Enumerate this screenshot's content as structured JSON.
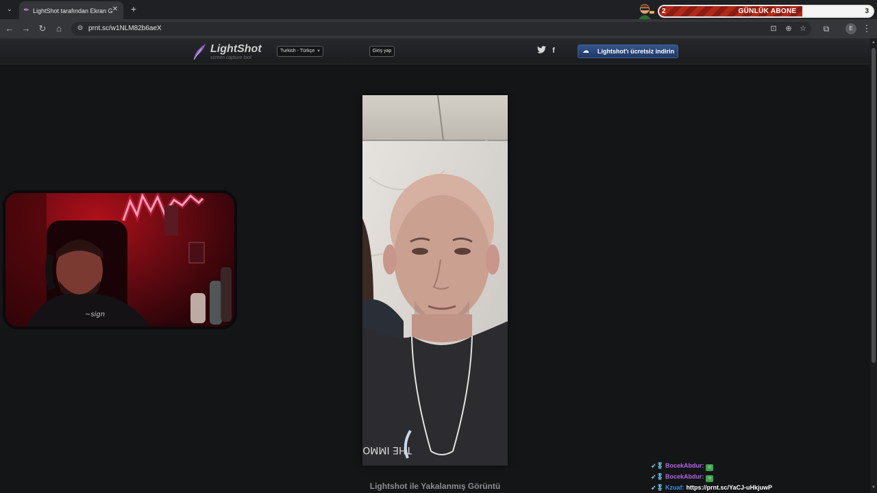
{
  "browser": {
    "tab": {
      "title": "LightShot tarafından Ekran Görüntüsü",
      "favicon": "feather-icon"
    },
    "url": "prnt.sc/w1NLM82b6aeX",
    "profile_initial": "E"
  },
  "stream_overlay": {
    "sub_goal": {
      "label": "GÜNLÜK ABONE",
      "current": "2",
      "target": "3",
      "progress": 0.67
    }
  },
  "site": {
    "logo_name": "LightShot",
    "logo_tagline": "screen capture tool",
    "language": "Turkish - Türkçe",
    "login": "Giriş yap",
    "download": "Lightshot'ı ücretsiz indirin",
    "caption": "Lightshot ile Yakalanmış Görüntü"
  },
  "screenshot": {
    "shirt_text": "THE IMMORTAL"
  },
  "chat": [
    {
      "user": "BocekAbdur:",
      "user_color": "#b565e8",
      "message": "",
      "emote": "emote"
    },
    {
      "user": "BocekAbdur:",
      "user_color": "#b565e8",
      "message": "",
      "emote": "emote"
    },
    {
      "user": "Kzuaf:",
      "user_color": "#3b8fe0",
      "message": "https://prnt.sc/YaCJ-uHkjuwP",
      "emote": ""
    }
  ]
}
